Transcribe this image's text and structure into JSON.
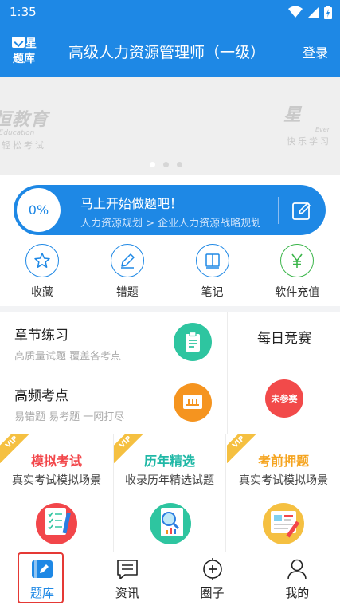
{
  "status_bar": {
    "time": "1:35"
  },
  "app_bar": {
    "logo_line1": "星",
    "logo_line2": "题库",
    "title": "高级人力资源管理师（一级）",
    "login_label": "登录"
  },
  "banner": {
    "left_brand": "恒教育",
    "left_sub": "r Education",
    "left_slogan": "轻松考试",
    "right_brand": "星",
    "right_sub": "Ever",
    "right_slogan": "快乐学习",
    "page_count": 3,
    "active_page": 1
  },
  "progress": {
    "percent_label": "0%",
    "title": "马上开始做题吧！",
    "path": "人力资源规划 > 企业人力资源战略规划"
  },
  "quick_actions": [
    {
      "label": "收藏",
      "icon": "star-icon"
    },
    {
      "label": "错题",
      "icon": "pencil-icon"
    },
    {
      "label": "笔记",
      "icon": "notebook-icon"
    },
    {
      "label": "软件充值",
      "icon": "yen-icon"
    }
  ],
  "practice": {
    "chapter": {
      "title": "章节练习",
      "subtitle": "高质量试题 覆盖各考点",
      "icon": "clipboard-icon",
      "color": "#2ec5a0"
    },
    "frequent": {
      "title": "高频考点",
      "subtitle": "易错题 易考题 一网打尽",
      "icon": "book-icon",
      "color": "#f5941f"
    },
    "daily": {
      "title": "每日竞赛",
      "badge": "未参赛",
      "color": "#f24a4a"
    }
  },
  "vip_cards": [
    {
      "ribbon": "VIP",
      "title": "模拟考试",
      "subtitle": "真实考试模拟场景",
      "title_color": "#f2464a",
      "icon": "checklist-icon"
    },
    {
      "ribbon": "VIP",
      "title": "历年精选",
      "subtitle": "收录历年精选试题",
      "title_color": "#20b8a6",
      "icon": "magnifier-report-icon"
    },
    {
      "ribbon": "VIP",
      "title": "考前押题",
      "subtitle": "真实考试模拟场景",
      "title_color": "#f5a41f",
      "icon": "exam-paper-icon"
    }
  ],
  "bottom_nav": [
    {
      "label": "题库",
      "icon": "question-bank-icon",
      "active": true
    },
    {
      "label": "资讯",
      "icon": "message-icon",
      "active": false
    },
    {
      "label": "圈子",
      "icon": "circle-plus-icon",
      "active": false
    },
    {
      "label": "我的",
      "icon": "person-icon",
      "active": false
    }
  ],
  "colors": {
    "primary": "#1e88e5",
    "highlight": "#e53935"
  }
}
